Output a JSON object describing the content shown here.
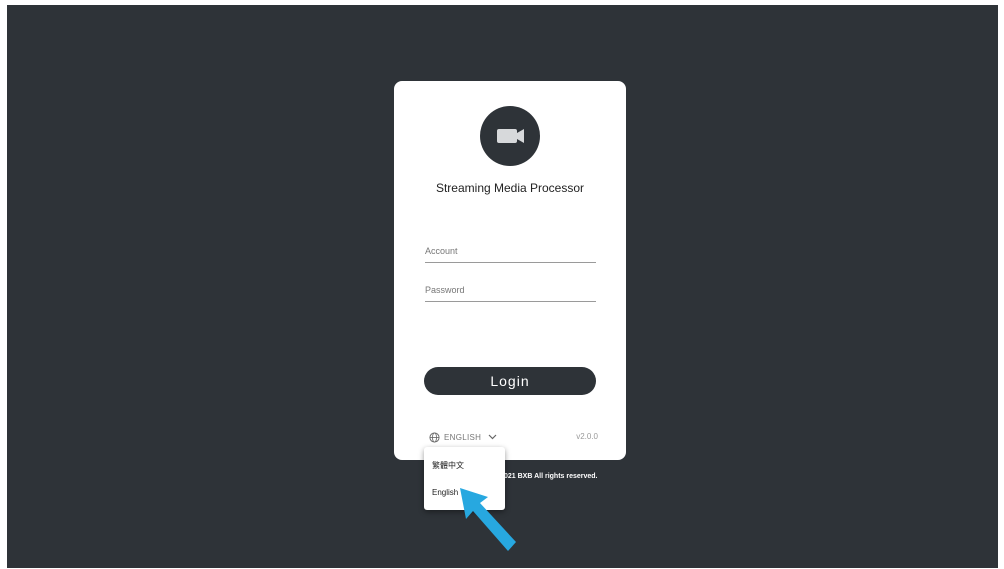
{
  "app": {
    "title": "Streaming Media Processor",
    "logo_icon": "video-camera-icon"
  },
  "form": {
    "account_placeholder": "Account",
    "password_placeholder": "Password",
    "login_label": "Login"
  },
  "footer": {
    "language_icon": "globe-icon",
    "language_label": "ENGLISH",
    "dropdown_icon": "chevron-down-icon",
    "version": "v2.0.0",
    "copyright": "021 BXB All rights reserved."
  },
  "language_menu": {
    "options": [
      "繁體中文",
      "English"
    ]
  },
  "annotation": {
    "arrow_icon": "pointer-arrow-icon",
    "arrow_color": "#27a8e0"
  },
  "colors": {
    "background": "#2e3338",
    "card": "#ffffff",
    "button": "#2e3338"
  }
}
